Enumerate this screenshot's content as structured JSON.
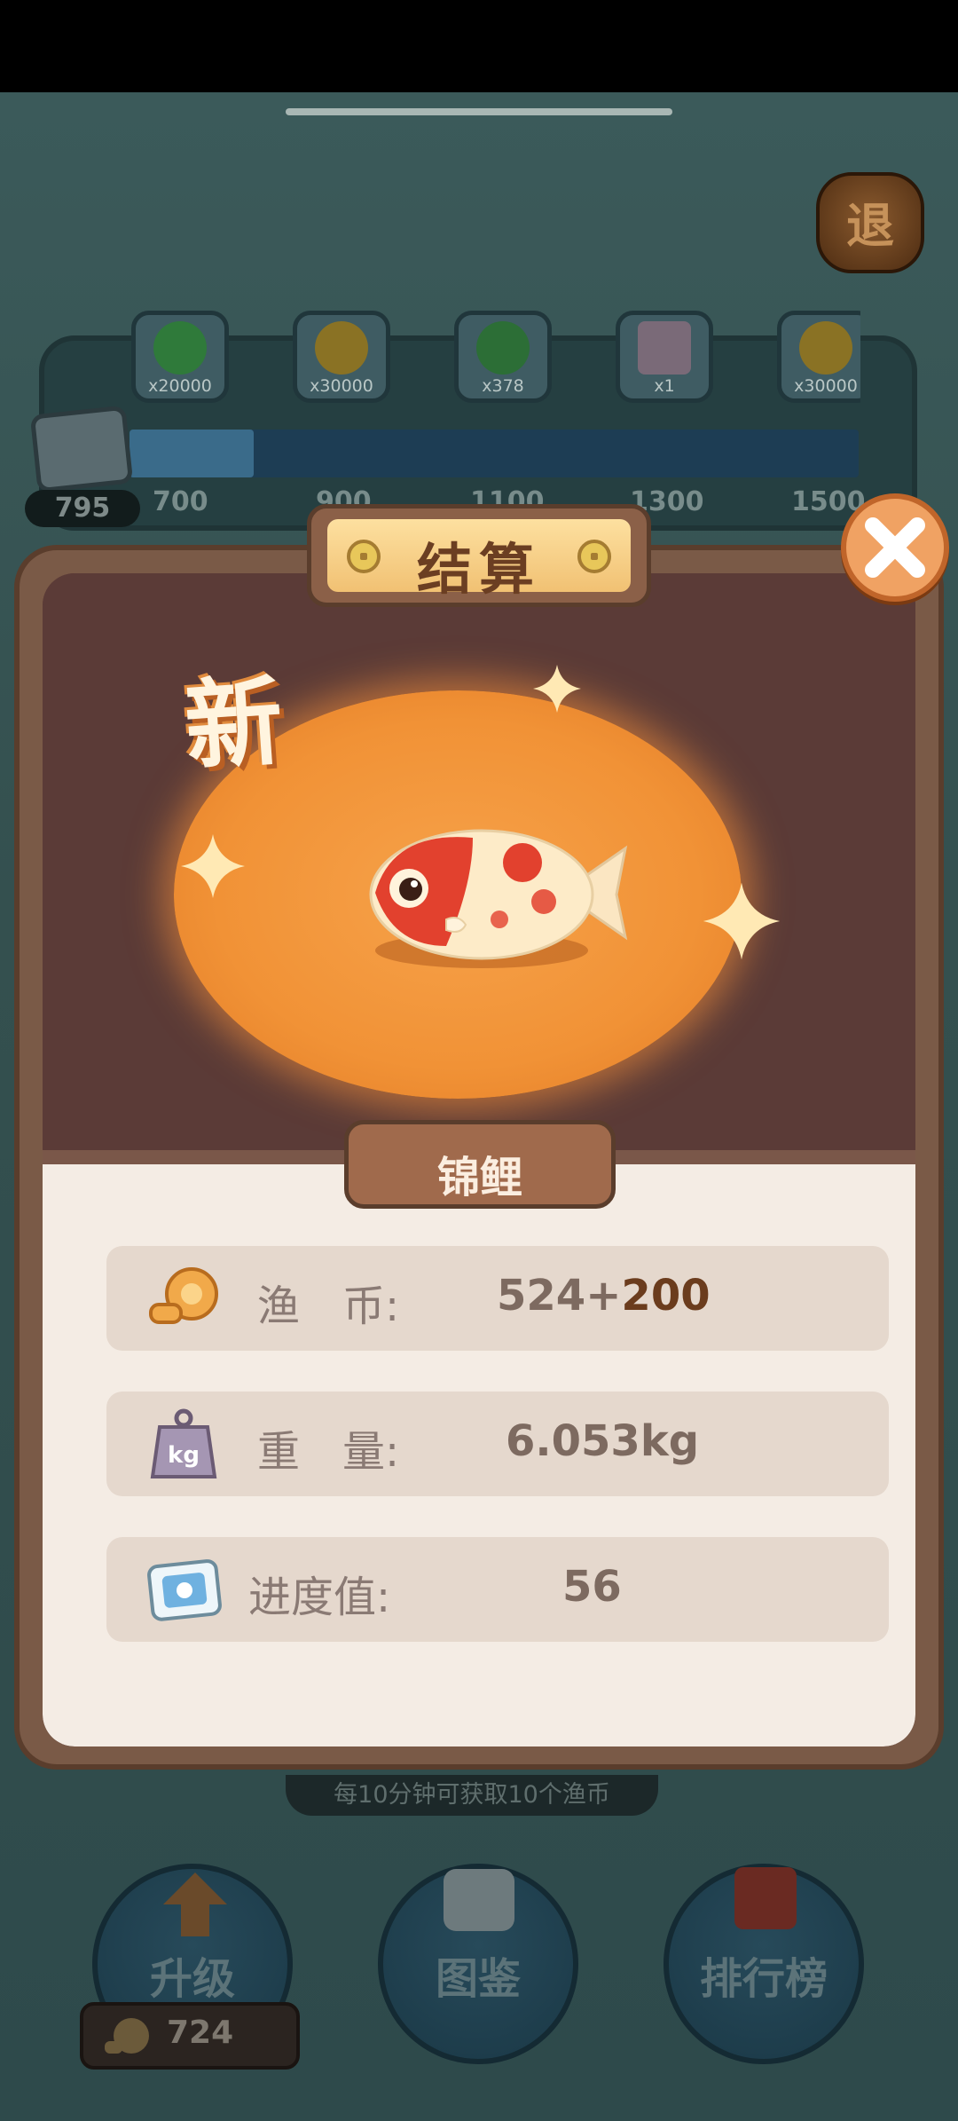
{
  "top_bar": {
    "exit_label": "退"
  },
  "progress": {
    "current_score": "795",
    "rewards": [
      {
        "icon": "check-icon",
        "qty": "x20000",
        "color": "#35a84a"
      },
      {
        "icon": "coin-icon",
        "qty": "x30000",
        "color": "#d9a62a"
      },
      {
        "icon": "bait-icon",
        "qty": "x378",
        "color": "#3aa34c"
      },
      {
        "icon": "character-card-icon",
        "qty": "x1",
        "color": "#e9b8d2"
      },
      {
        "icon": "coin-icon",
        "qty": "x30000",
        "color": "#d9a62a"
      }
    ],
    "milestones": [
      "700",
      "900",
      "1100",
      "1300",
      "1500"
    ]
  },
  "modal": {
    "title": "结算",
    "badge": "新",
    "fish_name": "锦鲤",
    "rows": [
      {
        "label": "渔　币:",
        "value_base": "524+",
        "value_bonus": "200",
        "icon": "fish-coin-icon"
      },
      {
        "label": "重　量:",
        "value": "6.053kg",
        "icon": "weight-kg-icon"
      },
      {
        "label": "进度值:",
        "value": "56",
        "icon": "progress-card-icon"
      }
    ]
  },
  "bottom": {
    "hint": "每10分钟可获取10个渔币",
    "buttons": [
      {
        "label": "升级",
        "icon": "upgrade-arrow-icon"
      },
      {
        "label": "图鉴",
        "icon": "encyclopedia-icon"
      },
      {
        "label": "排行榜",
        "icon": "leaderboard-icon"
      }
    ],
    "coins": "724"
  },
  "colors": {
    "accent_orange": "#f19236",
    "modal_brown": "#7a5a47",
    "panel_cream": "#f4ece4"
  }
}
